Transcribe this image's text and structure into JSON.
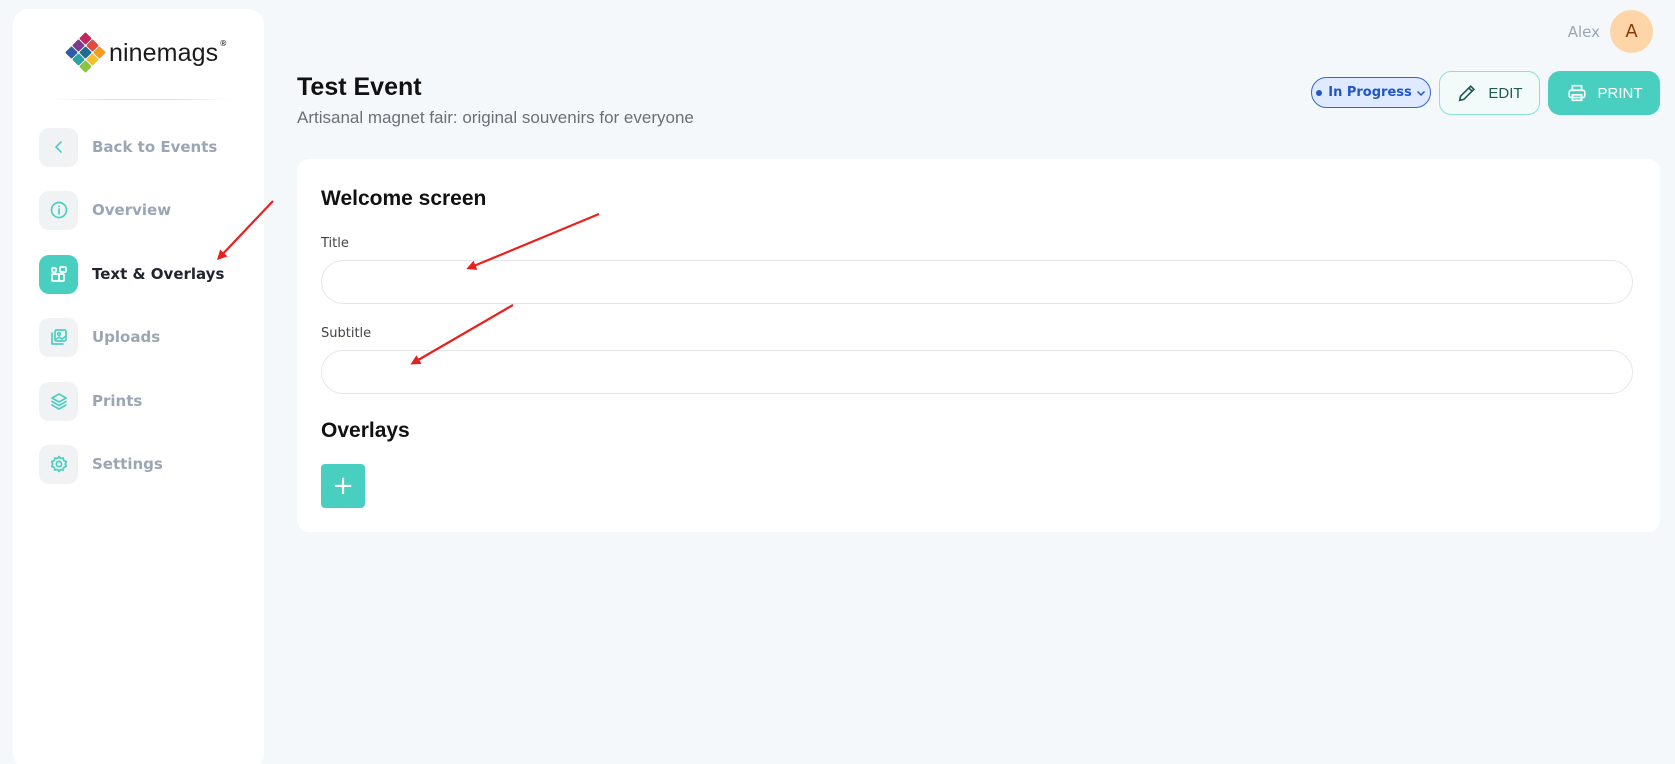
{
  "brand": {
    "name": "ninemags",
    "reg": "®"
  },
  "sidebar": {
    "items": [
      {
        "label": "Back to Events",
        "icon": "chevron-left-icon"
      },
      {
        "label": "Overview",
        "icon": "info-icon"
      },
      {
        "label": "Text & Overlays",
        "icon": "widgets-icon",
        "active": true
      },
      {
        "label": "Uploads",
        "icon": "images-icon"
      },
      {
        "label": "Prints",
        "icon": "layers-icon"
      },
      {
        "label": "Settings",
        "icon": "gear-icon"
      }
    ]
  },
  "user": {
    "name": "Alex",
    "initial": "A"
  },
  "header": {
    "title": "Test Event",
    "subtitle": "Artisanal magnet fair: original souvenirs for everyone",
    "status": "In Progress",
    "edit_label": "EDIT",
    "print_label": "PRINT"
  },
  "welcome": {
    "heading": "Welcome screen",
    "title_label": "Title",
    "title_value": "",
    "subtitle_label": "Subtitle",
    "subtitle_value": ""
  },
  "overlays": {
    "heading": "Overlays",
    "add_label": "+"
  },
  "colors": {
    "accent": "#49cfbf",
    "status": "#2156c7",
    "annotation": "#e8211e"
  }
}
